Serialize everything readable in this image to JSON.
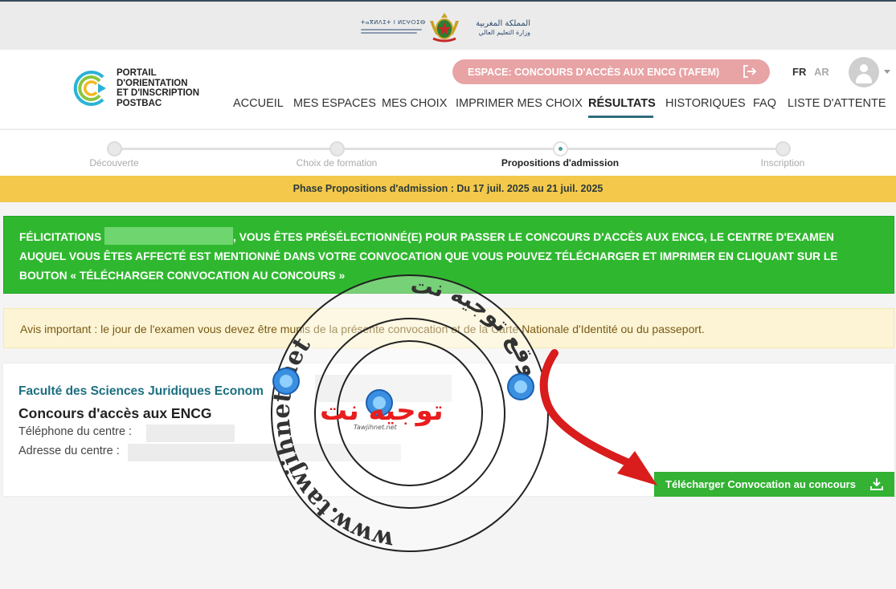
{
  "ministry": {
    "tifinagh_line": "ⵜⴰⴳⵍⴷⵉⵜ ⵏ ⵍⵎⵖⵔⵉⴱ",
    "arabic_title": "المملكة المغربية",
    "arabic_sub": "وزارة التعليم العالي"
  },
  "header": {
    "logo_lines": [
      "PORTAIL",
      "D'ORIENTATION",
      "ET D'INSCRIPTION",
      "POSTBAC"
    ],
    "space_label": "ESPACE: CONCOURS D'ACCÈS AUX ENCG (TAFEM)",
    "lang_fr": "FR",
    "lang_ar": "AR",
    "nav": [
      "ACCUEIL",
      "MES ESPACES",
      "MES CHOIX",
      "IMPRIMER MES CHOIX",
      "RÉSULTATS",
      "HISTORIQUES",
      "FAQ",
      "LISTE D'ATTENTE"
    ],
    "active_nav": "RÉSULTATS"
  },
  "stepper": {
    "steps": [
      "Découverte",
      "Choix de formation",
      "Propositions d'admission",
      "Inscription"
    ],
    "active_index": 2
  },
  "phase": {
    "text": "Phase Propositions d'admission : Du 17 juil. 2025 au 21 juil. 2025"
  },
  "success": {
    "prefix": "FÉLICITATIONS ",
    "suffix": ", VOUS ÊTES PRÉSÉLECTIONNÉ(E) POUR PASSER LE CONCOURS D'ACCÈS AUX ENCG, LE CENTRE D'EXAMEN AUQUEL VOUS ÊTES AFFECTÉ EST MENTIONNÉ DANS VOTRE CONVOCATION QUE VOUS POUVEZ TÉLÉCHARGER ET IMPRIMER EN CLIQUANT SUR LE BOUTON « TÉLÉCHARGER CONVOCATION AU CONCOURS »"
  },
  "warning": {
    "text": "Avis important : le jour de l'examen vous devez être munis de la présente convocation et de la Carte Nationale d'Identité ou du passeport."
  },
  "card": {
    "faculty": "Faculté des Sciences Juridiques Econom",
    "title": "Concours d'accès aux ENCG",
    "phone_label": "Téléphone du centre :",
    "address_label": "Adresse du centre :",
    "download_label": "Télécharger Convocation au concours"
  },
  "watermark": {
    "arabic": "توجيه نت",
    "site": "Tawjihnet.net",
    "ring_text": "www.tawjihnet.net",
    "ring_arabic": "موقع توجيه نت"
  }
}
